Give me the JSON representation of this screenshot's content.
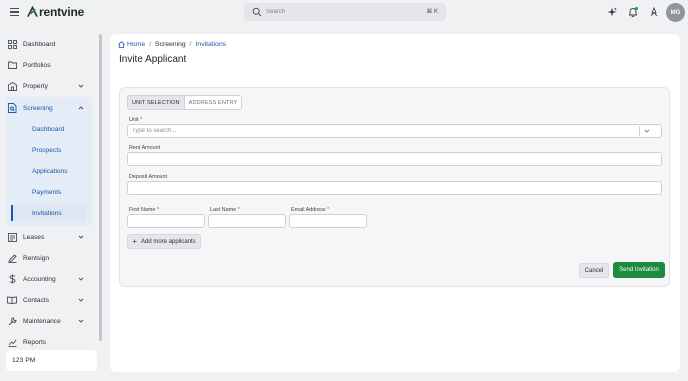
{
  "app": {
    "brand": "rentvine",
    "brand_color": "#1d8a3e",
    "accent_color": "#1f57a8"
  },
  "topbar": {
    "search_placeholder": "Search",
    "search_shortcut": "⌘ K",
    "icons": [
      "menu-icon",
      "sparkle-icon",
      "bell-icon",
      "user-icon"
    ],
    "avatar_initials": "MG"
  },
  "sidebar": {
    "items": [
      {
        "label": "Dashboard",
        "icon": "grid-icon"
      },
      {
        "label": "Portfolios",
        "icon": "folder-icon"
      },
      {
        "label": "Property",
        "icon": "building-icon"
      },
      {
        "label": "Screening",
        "icon": "document-search-icon"
      },
      {
        "label": "Leases",
        "icon": "lease-icon"
      },
      {
        "label": "Rentsign",
        "icon": "pen-icon"
      },
      {
        "label": "Accounting",
        "icon": "dollar-icon"
      },
      {
        "label": "Contacts",
        "icon": "contacts-icon"
      },
      {
        "label": "Maintenance",
        "icon": "wrench-icon"
      },
      {
        "label": "Reports",
        "icon": "chart-icon"
      }
    ],
    "screening_sub": [
      {
        "label": "Dashboard"
      },
      {
        "label": "Prospects"
      },
      {
        "label": "Applications"
      },
      {
        "label": "Payments"
      },
      {
        "label": "Invitations",
        "active": true
      }
    ],
    "clock": "123 PM"
  },
  "breadcrumb": {
    "home": "Home",
    "screening": "Screening",
    "current": "Invitations"
  },
  "page": {
    "title": "Invite Applicant"
  },
  "form": {
    "tabs": [
      "UNIT SELECTION",
      "ADDRESS ENTRY"
    ],
    "selected_tab": "UNIT SELECTION",
    "unit_label": "Unit",
    "unit_placeholder": "Type to search...",
    "rent_label": "Rent Amount",
    "rent_value": "",
    "deposit_label": "Deposit Amount",
    "deposit_value": "",
    "first_name_label": "First Name",
    "last_name_label": "Last Name",
    "email_label": "Email Address",
    "required_mark": "*",
    "add_more_label": "Add more applicants",
    "cancel_label": "Cancel",
    "send_label": "Send Invitation"
  }
}
